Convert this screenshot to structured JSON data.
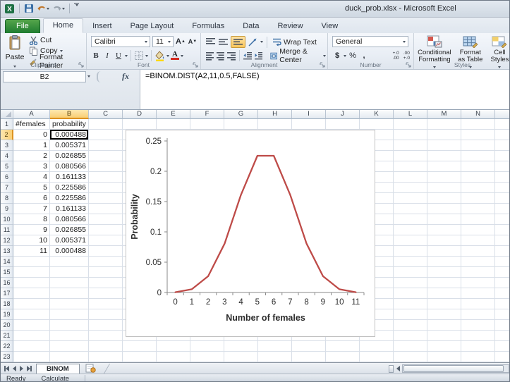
{
  "window": {
    "title": "duck_prob.xlsx - Microsoft Excel"
  },
  "qat": {
    "icons": [
      "excel-logo",
      "save",
      "undo",
      "redo",
      "customize-quick-access-toolbar"
    ]
  },
  "ribbon_tabs": [
    "File",
    "Home",
    "Insert",
    "Page Layout",
    "Formulas",
    "Data",
    "Review",
    "View"
  ],
  "active_tab": "Home",
  "ribbon": {
    "clipboard": {
      "title": "Clipboard",
      "paste": "Paste",
      "cut": "Cut",
      "copy": "Copy",
      "format_painter": "Format Painter"
    },
    "font": {
      "title": "Font",
      "name": "Calibri",
      "size": "11"
    },
    "alignment": {
      "title": "Alignment",
      "wrap": "Wrap Text",
      "merge": "Merge & Center"
    },
    "number": {
      "title": "Number",
      "format": "General",
      "currency": "$",
      "percent": "%",
      "comma": ",",
      "inc_decimal_top": "+.0",
      "inc_decimal_bot": ".00",
      "dec_decimal_top": ".00",
      "dec_decimal_bot": "+.0"
    },
    "styles": {
      "title": "Styles",
      "conditional_1": "Conditional",
      "conditional_2": "Formatting",
      "table_1": "Format",
      "table_2": "as Table",
      "cells_1": "Cell",
      "cells_2": "Styles"
    }
  },
  "formula_bar": {
    "name_box": "B2",
    "fx": "fx",
    "formula": "=BINOM.DIST(A2,11,0.5,FALSE)"
  },
  "grid": {
    "columns": [
      "A",
      "B",
      "C",
      "D",
      "E",
      "F",
      "G",
      "H",
      "I",
      "J",
      "K",
      "L",
      "M",
      "N"
    ],
    "row_count": 23,
    "selected": {
      "col": "B",
      "row": 2
    },
    "cells": [
      {
        "row": 1,
        "A": "#females",
        "B": "probability"
      },
      {
        "row": 2,
        "A": "0",
        "B": "0.000488"
      },
      {
        "row": 3,
        "A": "1",
        "B": "0.005371"
      },
      {
        "row": 4,
        "A": "2",
        "B": "0.026855"
      },
      {
        "row": 5,
        "A": "3",
        "B": "0.080566"
      },
      {
        "row": 6,
        "A": "4",
        "B": "0.161133"
      },
      {
        "row": 7,
        "A": "5",
        "B": "0.225586"
      },
      {
        "row": 8,
        "A": "6",
        "B": "0.225586"
      },
      {
        "row": 9,
        "A": "7",
        "B": "0.161133"
      },
      {
        "row": 10,
        "A": "8",
        "B": "0.080566"
      },
      {
        "row": 11,
        "A": "9",
        "B": "0.026855"
      },
      {
        "row": 12,
        "A": "10",
        "B": "0.005371"
      },
      {
        "row": 13,
        "A": "11",
        "B": "0.000488"
      }
    ]
  },
  "chart_data": {
    "type": "line",
    "x": [
      0,
      1,
      2,
      3,
      4,
      5,
      6,
      7,
      8,
      9,
      10,
      11
    ],
    "values": [
      0.000488,
      0.005371,
      0.026855,
      0.080566,
      0.161133,
      0.225586,
      0.225586,
      0.161133,
      0.080566,
      0.026855,
      0.005371,
      0.000488
    ],
    "xlabel": "Number of females",
    "ylabel": "Probability",
    "ylim": [
      0,
      0.25
    ],
    "yticks": [
      0,
      0.05,
      0.1,
      0.15,
      0.2,
      0.25
    ],
    "ytick_labels": [
      "0",
      "0.05",
      "0.1",
      "0.15",
      "0.2",
      "0.25"
    ],
    "xtick_labels": [
      "0",
      "1",
      "2",
      "3",
      "4",
      "5",
      "6",
      "7",
      "8",
      "9",
      "10",
      "11"
    ],
    "grid": false,
    "legend": false,
    "line_color": "#be4b48",
    "axis_color": "#8a8a8a",
    "label_color": "#2b2b2b"
  },
  "sheet_bar": {
    "tab": "BINOM"
  },
  "status_bar": {
    "mode": "Ready",
    "calc": "Calculate"
  },
  "colors": {
    "file_tab_green": "#2f8c3c",
    "selected_header": "#f9cf74",
    "selection_border": "#000000"
  }
}
